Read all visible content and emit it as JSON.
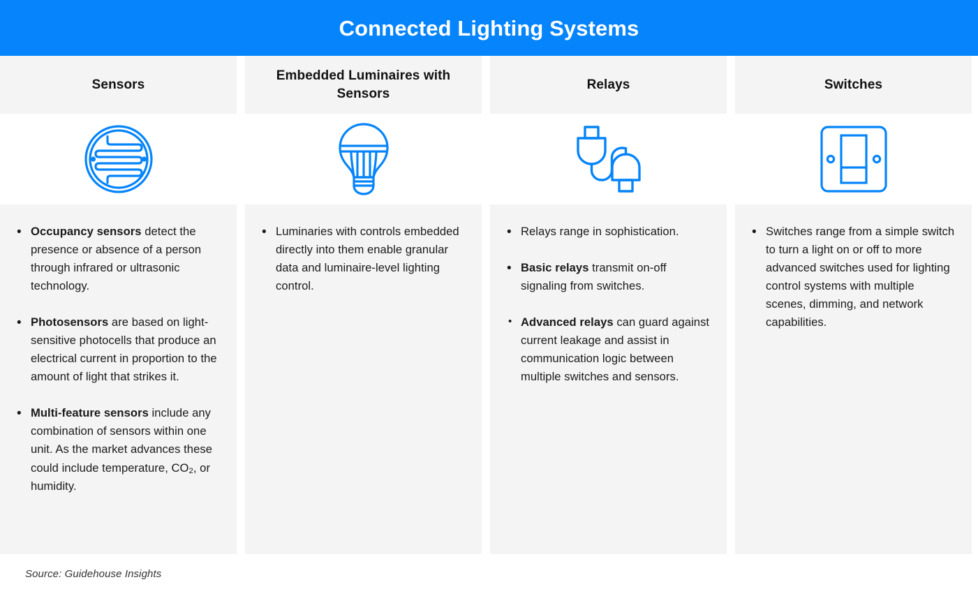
{
  "header": {
    "title": "Connected Lighting Systems",
    "background_color": "#0584fb",
    "text_color": "#ffffff"
  },
  "theme": {
    "accent_color": "#0584fb",
    "panel_color": "#f4f4f4",
    "page_background": "#ffffff",
    "body_text_color": "#1a1a1a"
  },
  "columns": [
    {
      "heading": "Sensors",
      "icon": "photosensor-circle-icon",
      "bullets": [
        {
          "bold_lead": "Occupancy sensors",
          "rest": " detect the presence or absence of a person through infrared or ultrasonic technology.",
          "small_bullet": false
        },
        {
          "bold_lead": "Photosensors",
          "rest": " are based on light-sensitive photocells that produce an electrical current in proportion to the amount of light that strikes it.",
          "small_bullet": false
        },
        {
          "bold_lead": "Multi-feature sensors",
          "rest": " include any combination of sensors within one unit. As the market advances these could include temperature, CO",
          "subscript": "2",
          "tail": ", or humidity.",
          "small_bullet": false
        }
      ]
    },
    {
      "heading": "Embedded Luminaires with Sensors",
      "icon": "lightbulb-icon",
      "bullets": [
        {
          "bold_lead": "",
          "rest": "Luminaries with controls embedded directly into them enable granular data and luminaire-level lighting control.",
          "small_bullet": false
        }
      ]
    },
    {
      "heading": "Relays",
      "icon": "plug-cable-icon",
      "bullets": [
        {
          "bold_lead": "",
          "rest": "Relays range in sophistication.",
          "small_bullet": false
        },
        {
          "bold_lead": "Basic relays",
          "rest": " transmit on-off signaling from switches.",
          "small_bullet": false
        },
        {
          "bold_lead": "Advanced relays",
          "rest": " can guard against current leakage and assist in communication logic between multiple switches and sensors.",
          "small_bullet": true
        }
      ]
    },
    {
      "heading": "Switches",
      "icon": "wall-switch-icon",
      "bullets": [
        {
          "bold_lead": "",
          "rest": "Switches range from a simple switch to turn a light on or off to more advanced switches used for lighting control systems with multiple scenes, dimming, and network capabilities.",
          "small_bullet": false
        }
      ]
    }
  ],
  "footer": {
    "source": "Source: Guidehouse Insights"
  }
}
